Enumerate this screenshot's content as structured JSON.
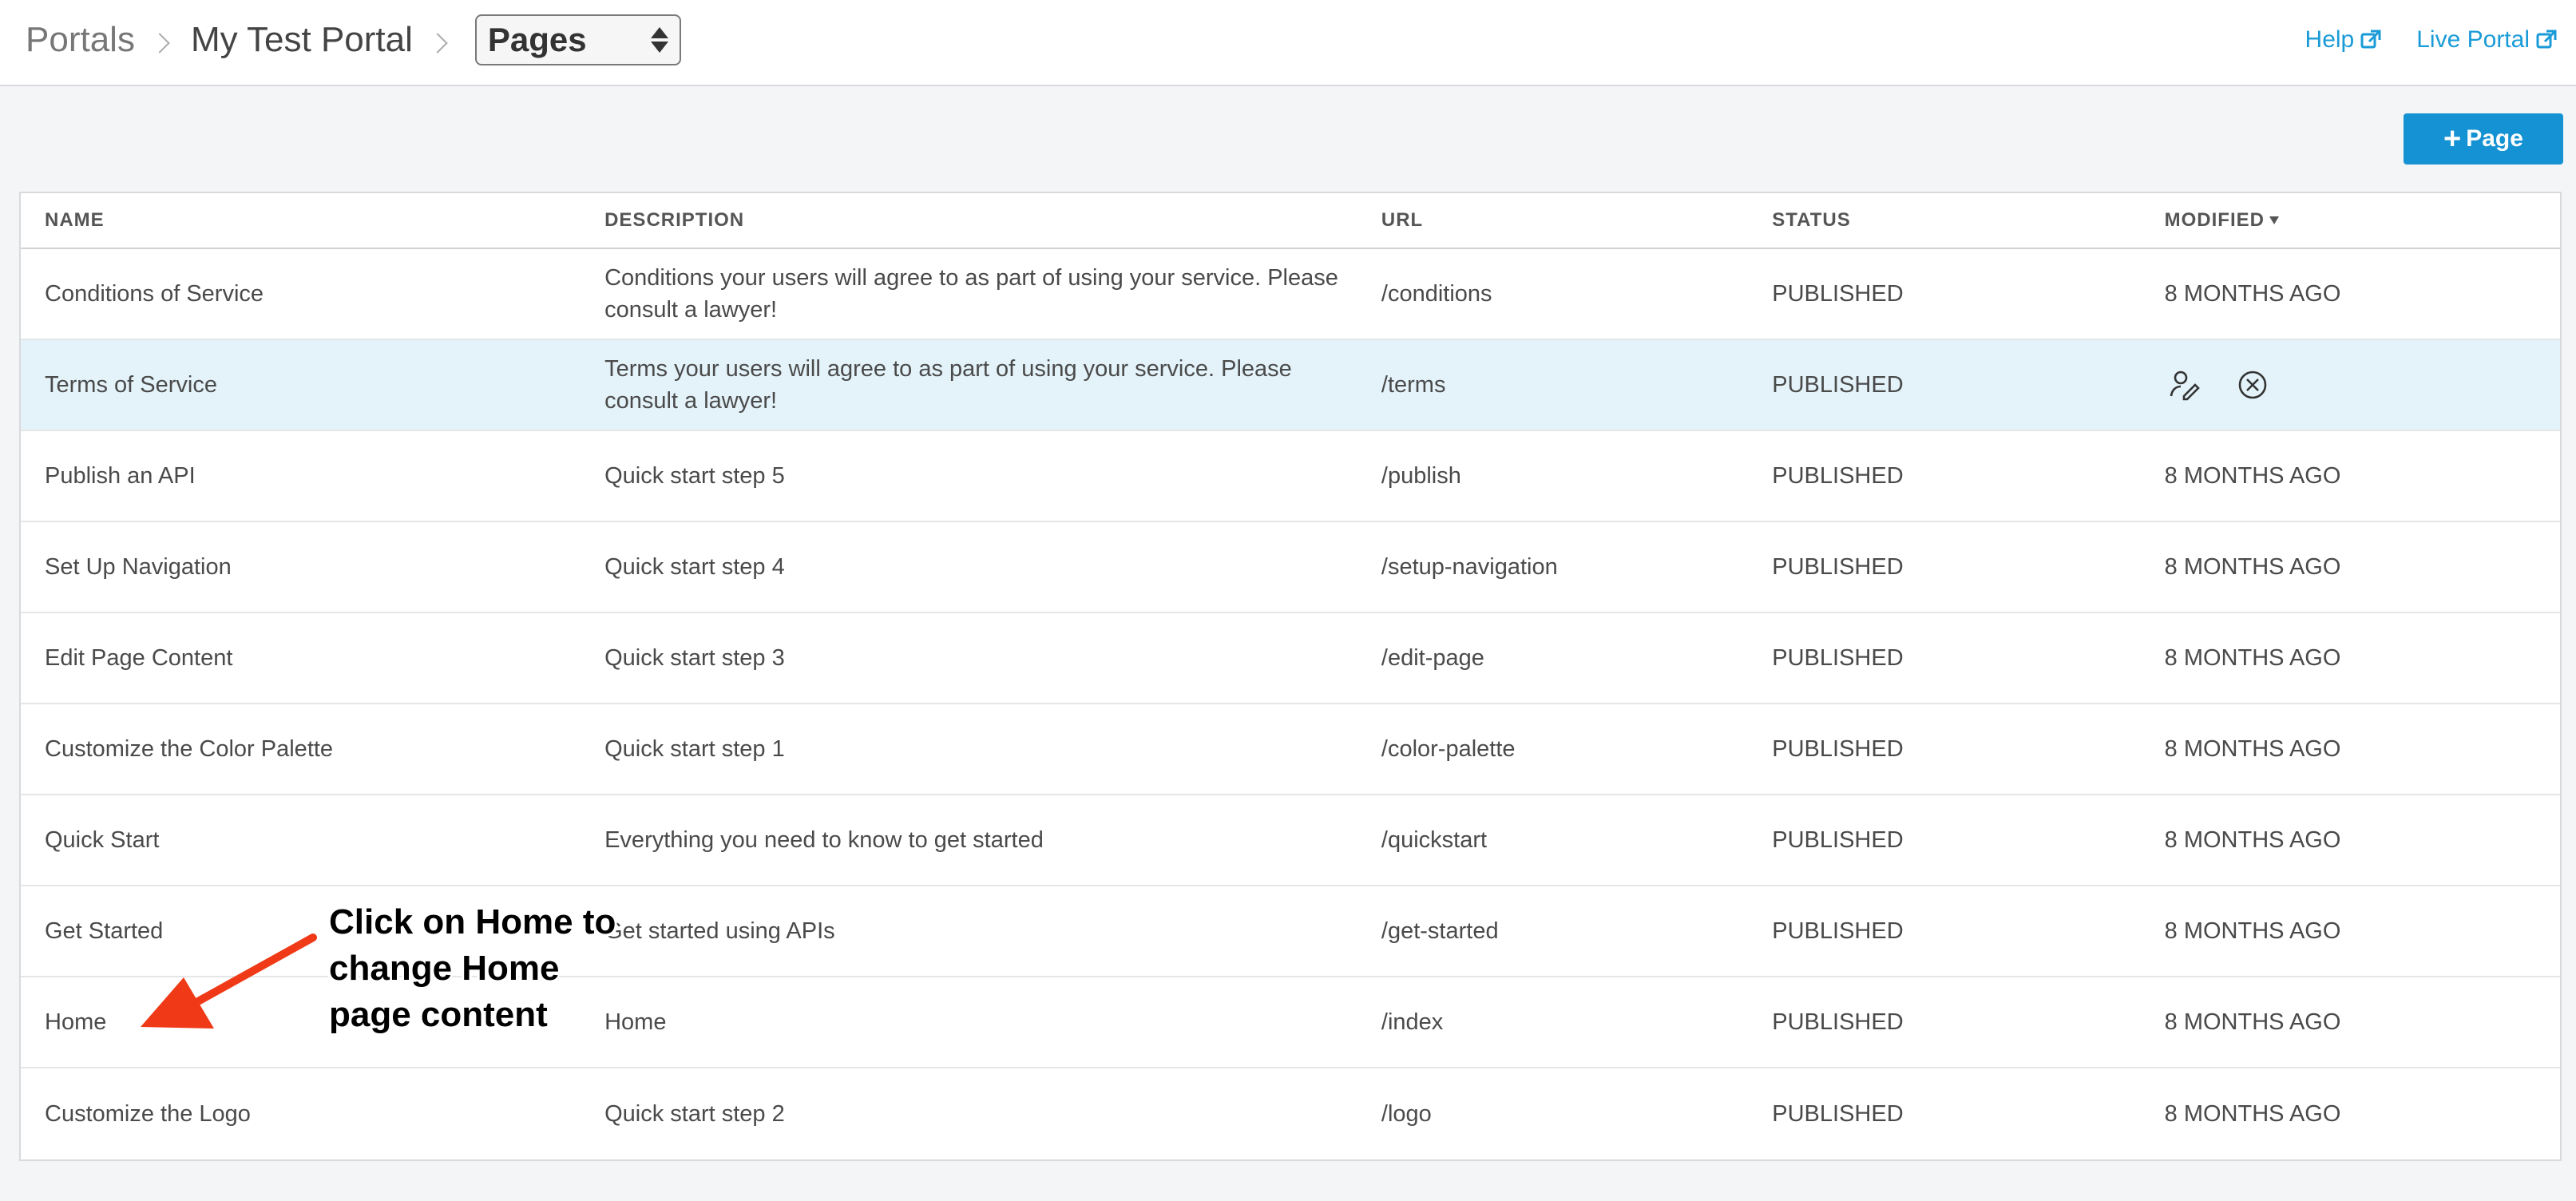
{
  "header": {
    "breadcrumbs": [
      "Portals",
      "My Test Portal"
    ],
    "page_select": "Pages",
    "links": [
      {
        "label": "Help",
        "icon": "external-link-icon"
      },
      {
        "label": "Live Portal",
        "icon": "external-link-icon"
      }
    ]
  },
  "toolbar": {
    "add_label": "Page",
    "add_icon": "plus-icon"
  },
  "table": {
    "columns": [
      "NAME",
      "DESCRIPTION",
      "URL",
      "STATUS",
      "MODIFIED"
    ],
    "rows": [
      {
        "name": "Conditions of Service",
        "description": "Conditions your users will agree to as part of using your service. Please consult a lawyer!",
        "url": "/conditions",
        "status": "PUBLISHED",
        "modified": "8 MONTHS AGO"
      },
      {
        "name": "Terms of Service",
        "description": "Terms your users will agree to as part of using your service. Please consult a lawyer!",
        "url": "/terms",
        "status": "PUBLISHED",
        "modified": ""
      },
      {
        "name": "Publish an API",
        "description": "Quick start step 5",
        "url": "/publish",
        "status": "PUBLISHED",
        "modified": "8 MONTHS AGO"
      },
      {
        "name": "Set Up Navigation",
        "description": "Quick start step 4",
        "url": "/setup-navigation",
        "status": "PUBLISHED",
        "modified": "8 MONTHS AGO"
      },
      {
        "name": "Edit Page Content",
        "description": "Quick start step 3",
        "url": "/edit-page",
        "status": "PUBLISHED",
        "modified": "8 MONTHS AGO"
      },
      {
        "name": "Customize the Color Palette",
        "description": "Quick start step 1",
        "url": "/color-palette",
        "status": "PUBLISHED",
        "modified": "8 MONTHS AGO"
      },
      {
        "name": "Quick Start",
        "description": "Everything you need to know to get started",
        "url": "/quickstart",
        "status": "PUBLISHED",
        "modified": "8 MONTHS AGO"
      },
      {
        "name": "Get Started",
        "description": "Get started using APIs",
        "url": "/get-started",
        "status": "PUBLISHED",
        "modified": "8 MONTHS AGO"
      },
      {
        "name": "Home",
        "description": "Home",
        "url": "/index",
        "status": "PUBLISHED",
        "modified": "8 MONTHS AGO"
      },
      {
        "name": "Customize the Logo",
        "description": "Quick start step 2",
        "url": "/logo",
        "status": "PUBLISHED",
        "modified": "8 MONTHS AGO"
      }
    ],
    "hover_row_actions": [
      "edit-icon",
      "delete-icon"
    ]
  },
  "annotation": {
    "lines": [
      "Click on Home to",
      "change Home",
      "page content"
    ]
  },
  "colors": {
    "accent": "#1592d3",
    "link": "#1a9bd7",
    "row_highlight": "#e4f3fa",
    "arrow": "#f03a17"
  }
}
